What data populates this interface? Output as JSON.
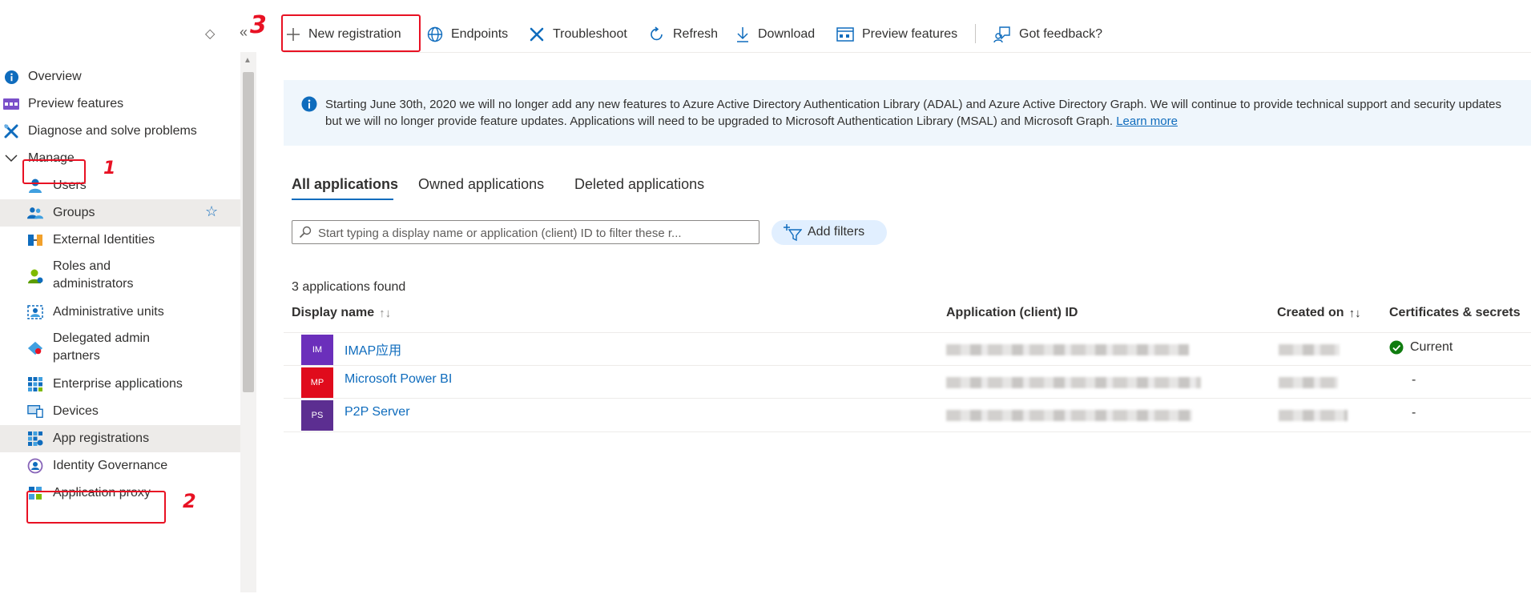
{
  "top_controls": {
    "expand_glyph": "◇",
    "collapse_glyph": "«"
  },
  "sidebar": {
    "items": [
      {
        "label": "Overview",
        "icon": "info-icon"
      },
      {
        "label": "Preview features",
        "icon": "preview-features-icon"
      },
      {
        "label": "Diagnose and solve problems",
        "icon": "wrench-icon"
      },
      {
        "label": "Manage",
        "icon": "chevron-down-icon"
      },
      {
        "label": "Users",
        "icon": "user-icon"
      },
      {
        "label": "Groups",
        "icon": "group-icon",
        "selected": true
      },
      {
        "label": "External Identities",
        "icon": "external-identities-icon"
      },
      {
        "label": "Roles and administrators",
        "icon": "roles-icon"
      },
      {
        "label": "Administrative units",
        "icon": "admin-units-icon"
      },
      {
        "label": "Delegated admin partners",
        "icon": "delegated-admin-icon"
      },
      {
        "label": "Enterprise applications",
        "icon": "enterprise-apps-icon"
      },
      {
        "label": "Devices",
        "icon": "devices-icon"
      },
      {
        "label": "App registrations",
        "icon": "app-registrations-icon"
      },
      {
        "label": "Identity Governance",
        "icon": "identity-governance-icon"
      },
      {
        "label": "Application proxy",
        "icon": "app-proxy-icon"
      }
    ],
    "roles_line1": "Roles and",
    "roles_line2": "administrators",
    "delegated_line1": "Delegated admin",
    "delegated_line2": "partners",
    "favorite_glyph": "☆"
  },
  "toolbar": {
    "new_registration": "New registration",
    "endpoints": "Endpoints",
    "troubleshoot": "Troubleshoot",
    "refresh": "Refresh",
    "download": "Download",
    "preview_features": "Preview features",
    "feedback": "Got feedback?"
  },
  "banner": {
    "text": "Starting June 30th, 2020 we will no longer add any new features to Azure Active Directory Authentication Library (ADAL) and Azure Active Directory Graph. We will continue to provide technical support and security updates but we will no longer provide feature updates. Applications will need to be upgraded to Microsoft Authentication Library (MSAL) and Microsoft Graph.",
    "link": "Learn more"
  },
  "tabs": [
    "All applications",
    "Owned applications",
    "Deleted applications"
  ],
  "search": {
    "placeholder": "Start typing a display name or application (client) ID to filter these r..."
  },
  "add_filters": "Add filters",
  "results_count": "3 applications found",
  "columns": {
    "display_name": "Display name",
    "client_id": "Application (client) ID",
    "created_on": "Created on",
    "certs": "Certificates & secrets",
    "sort_glyph_light": "↑↓",
    "sort_glyph_dark": "↑↓"
  },
  "rows": [
    {
      "initials": "IM",
      "name": "IMAP应用",
      "color": "#6b2fbb",
      "cert": "Current"
    },
    {
      "initials": "MP",
      "name": "Microsoft Power BI",
      "color": "#e00b1c",
      "cert": "-"
    },
    {
      "initials": "PS",
      "name": "P2P Server",
      "color": "#5c2e91",
      "cert": "-"
    }
  ],
  "annotations": [
    "1",
    "2",
    "3"
  ],
  "colors": {
    "accent": "#0f6cbd",
    "annotation": "#e81123",
    "banner_bg": "#eff6fc"
  }
}
